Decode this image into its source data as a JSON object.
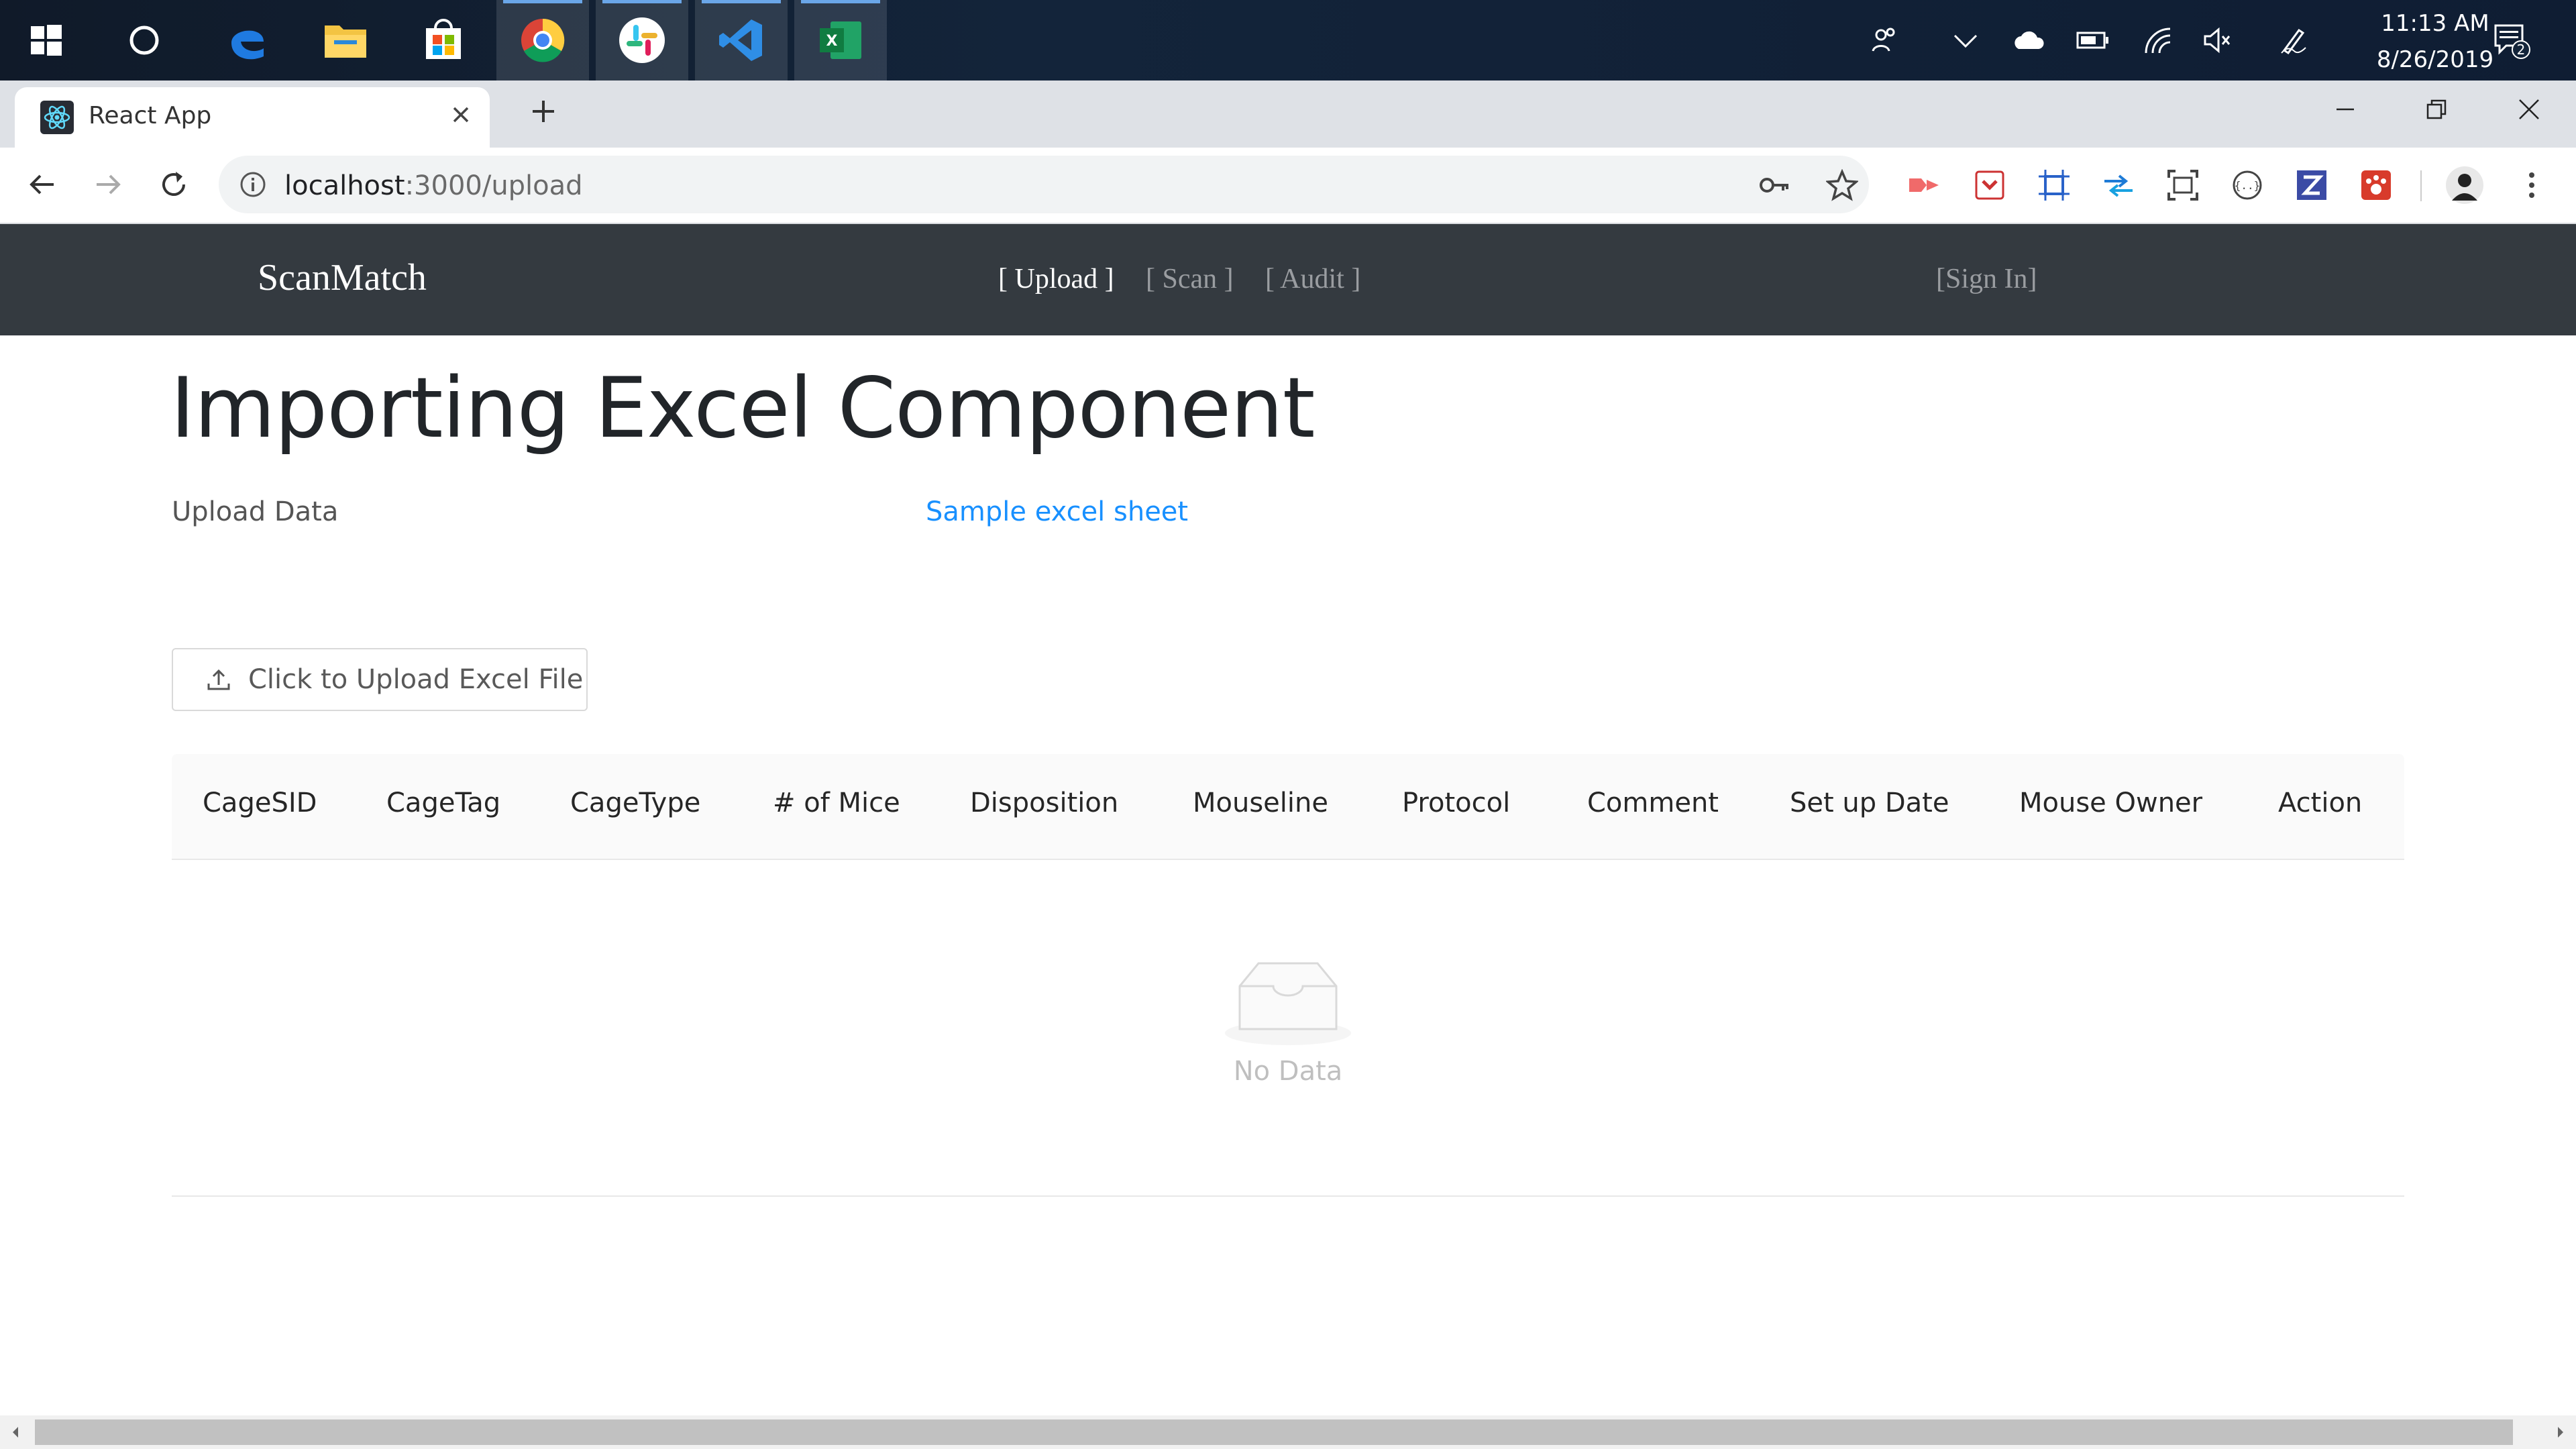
{
  "taskbar": {
    "clock_time": "11:13 AM",
    "clock_date": "8/26/2019",
    "notification_count": "2",
    "apps": [
      "windows-start",
      "cortana",
      "edge",
      "file-explorer",
      "store",
      "chrome",
      "slack",
      "vscode",
      "excel"
    ]
  },
  "browser": {
    "tab_title": "React App",
    "url_host": "localhost",
    "url_rest": ":3000/upload"
  },
  "navbar": {
    "brand": "ScanMatch",
    "links": [
      "[ Upload ]",
      "[ Scan ]",
      "[ Audit ]"
    ],
    "active_link": "[ Upload ]",
    "signin": "[Sign In]"
  },
  "main": {
    "title": "Importing Excel Component",
    "upload_label": "Upload Data",
    "sample_link": "Sample excel sheet",
    "upload_button": "Click to Upload Excel File",
    "table": {
      "columns": [
        "CageSID",
        "CageTag",
        "CageType",
        "# of Mice",
        "Disposition",
        "Mouseline",
        "Protocol",
        "Comment",
        "Set up Date",
        "Mouse Owner",
        "Action"
      ],
      "empty_text": "No Data"
    }
  },
  "colors": {
    "navbar_bg": "#343a40",
    "link_blue": "#1890ff",
    "taskbar_bg": "#13243a"
  }
}
